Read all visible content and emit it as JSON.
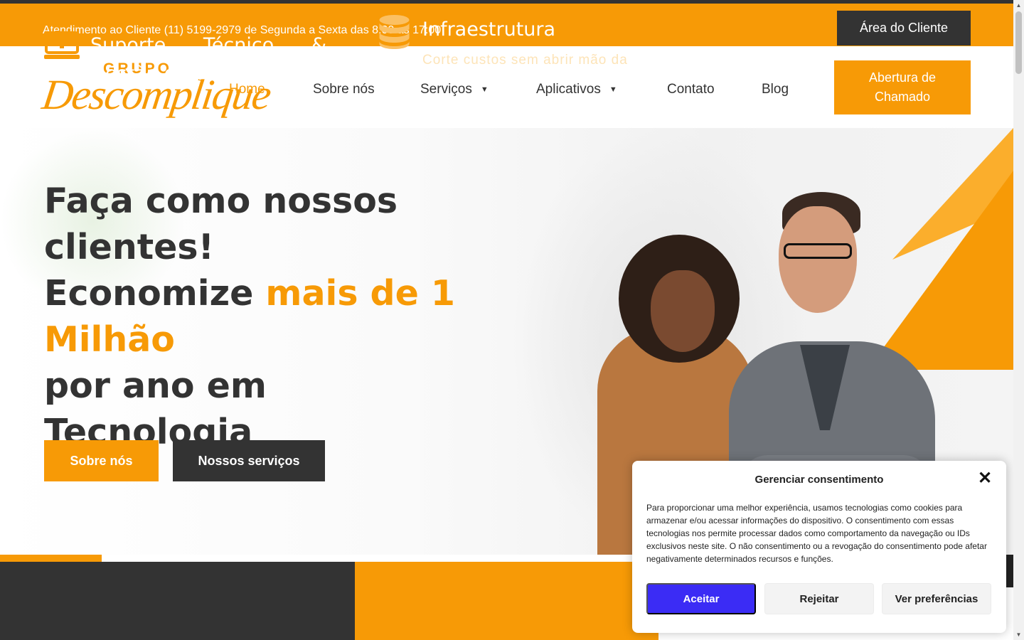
{
  "topbar": {
    "support_text": "Atendimento ao Cliente (11) 5199-2979 de Segunda a Sexta das 8:00 as 17:00",
    "client_area_label": "Área do Cliente"
  },
  "logo": {
    "top": "GRUPO",
    "main": "Descomplique"
  },
  "nav": {
    "items": [
      {
        "label": "Home",
        "active": true
      },
      {
        "label": "Sobre nós"
      },
      {
        "label": "Serviços",
        "dropdown": true
      },
      {
        "label": "Aplicativos",
        "dropdown": true
      },
      {
        "label": "Contato"
      },
      {
        "label": "Blog"
      }
    ],
    "cta_label": "Abertura de Chamado"
  },
  "hero": {
    "line1": "Faça como nossos clientes!",
    "line2_prefix": "Economize ",
    "line2_accent": "mais de 1 Milhão",
    "line3": "por ano em Tecnologia",
    "btn_about": "Sobre nós",
    "btn_services": "Nossos serviços"
  },
  "services": {
    "items": [
      {
        "title": "Suporte Técnico & Gestão de TI",
        "icon": "monitor-plus-icon"
      },
      {
        "title": "Infraestrutura",
        "desc": "Corte custos sem abrir mão da",
        "icon": "database-icon"
      }
    ]
  },
  "consent": {
    "title": "Gerenciar consentimento",
    "text": "Para proporcionar uma melhor experiência, usamos tecnologias como cookies para armazenar e/ou acessar informações do dispositivo. O consentimento com essas tecnologias nos permite processar dados como comportamento da navegação ou IDs exclusivos neste site. O não consentimento ou a revogação do consentimento pode afetar negativamente determinados recursos e funções.",
    "accept": "Aceitar",
    "reject": "Rejeitar",
    "preferences": "Ver preferências"
  },
  "colors": {
    "accent": "#f79a06",
    "dark": "#333333",
    "consent_accept": "#3b2cf5"
  }
}
